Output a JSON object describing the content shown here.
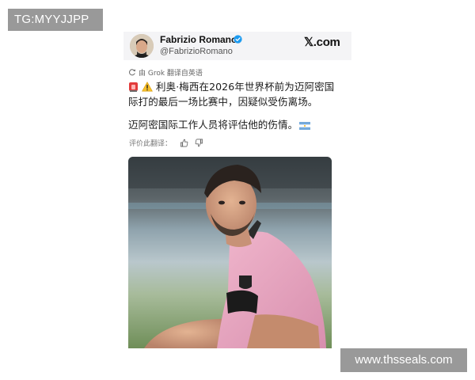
{
  "watermarks": {
    "top_left": "TG:MYYJJPP",
    "bottom_right": "www.thsseals.com"
  },
  "post": {
    "author": {
      "name": "Fabrizio Romano",
      "handle": "@FabrizioRomano",
      "verified": true,
      "avatar_icon": "avatar-photo"
    },
    "brand": "𝕏.com",
    "translation_notice": "由 Grok 翻译自英语",
    "text": {
      "line1": "利奥·梅西在2026年世界杯前为迈阿密国",
      "line2": "际打的最后一场比赛中，因疑似受伤离场。",
      "para2": "迈阿密国际工作人员将评估他的伤情。"
    },
    "emojis": [
      "siren-icon",
      "warning-icon",
      "argentina-flag-icon"
    ],
    "rate_translation_label": "评价此翻译：",
    "image_icon": "player-photo"
  },
  "colors": {
    "header_bg": "#f4f4f6",
    "verified_blue": "#1d9bf0",
    "watermark_bg": "#999999",
    "jersey_pink": "#e8a7c0"
  }
}
